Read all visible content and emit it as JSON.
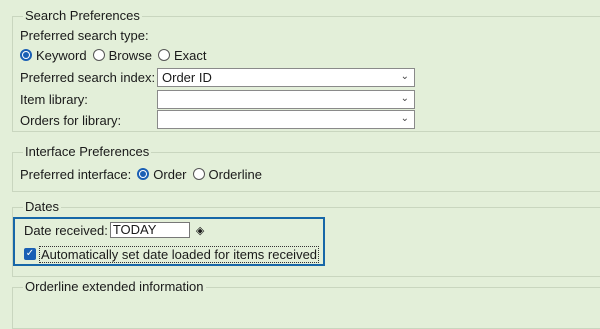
{
  "search": {
    "legend": "Search Preferences",
    "type_label": "Preferred search type:",
    "options": [
      {
        "label": "Keyword",
        "checked": true
      },
      {
        "label": "Browse",
        "checked": false
      },
      {
        "label": "Exact",
        "checked": false
      }
    ],
    "index_label": "Preferred search index:",
    "index_value": "Order ID",
    "item_library_label": "Item library:",
    "item_library_value": "",
    "orders_library_label": "Orders for library:",
    "orders_library_value": ""
  },
  "interface": {
    "legend": "Interface Preferences",
    "label": "Preferred interface:",
    "options": [
      {
        "label": "Order",
        "checked": true
      },
      {
        "label": "Orderline",
        "checked": false
      }
    ]
  },
  "dates": {
    "legend": "Dates",
    "date_received_label": "Date received:",
    "date_received_value": "TODAY",
    "auto_set_label": "Automatically set date loaded for items received",
    "auto_set_checked": true
  },
  "orderline": {
    "legend": "Orderline extended information"
  },
  "icons": {
    "calendar": "calendar-picker-icon",
    "dropdown": "chevron-down-icon",
    "checkmark": "checkmark-icon"
  },
  "colors": {
    "background": "#e3efd9",
    "accent": "#1a5fb4",
    "focus_border": "#1767a8"
  }
}
